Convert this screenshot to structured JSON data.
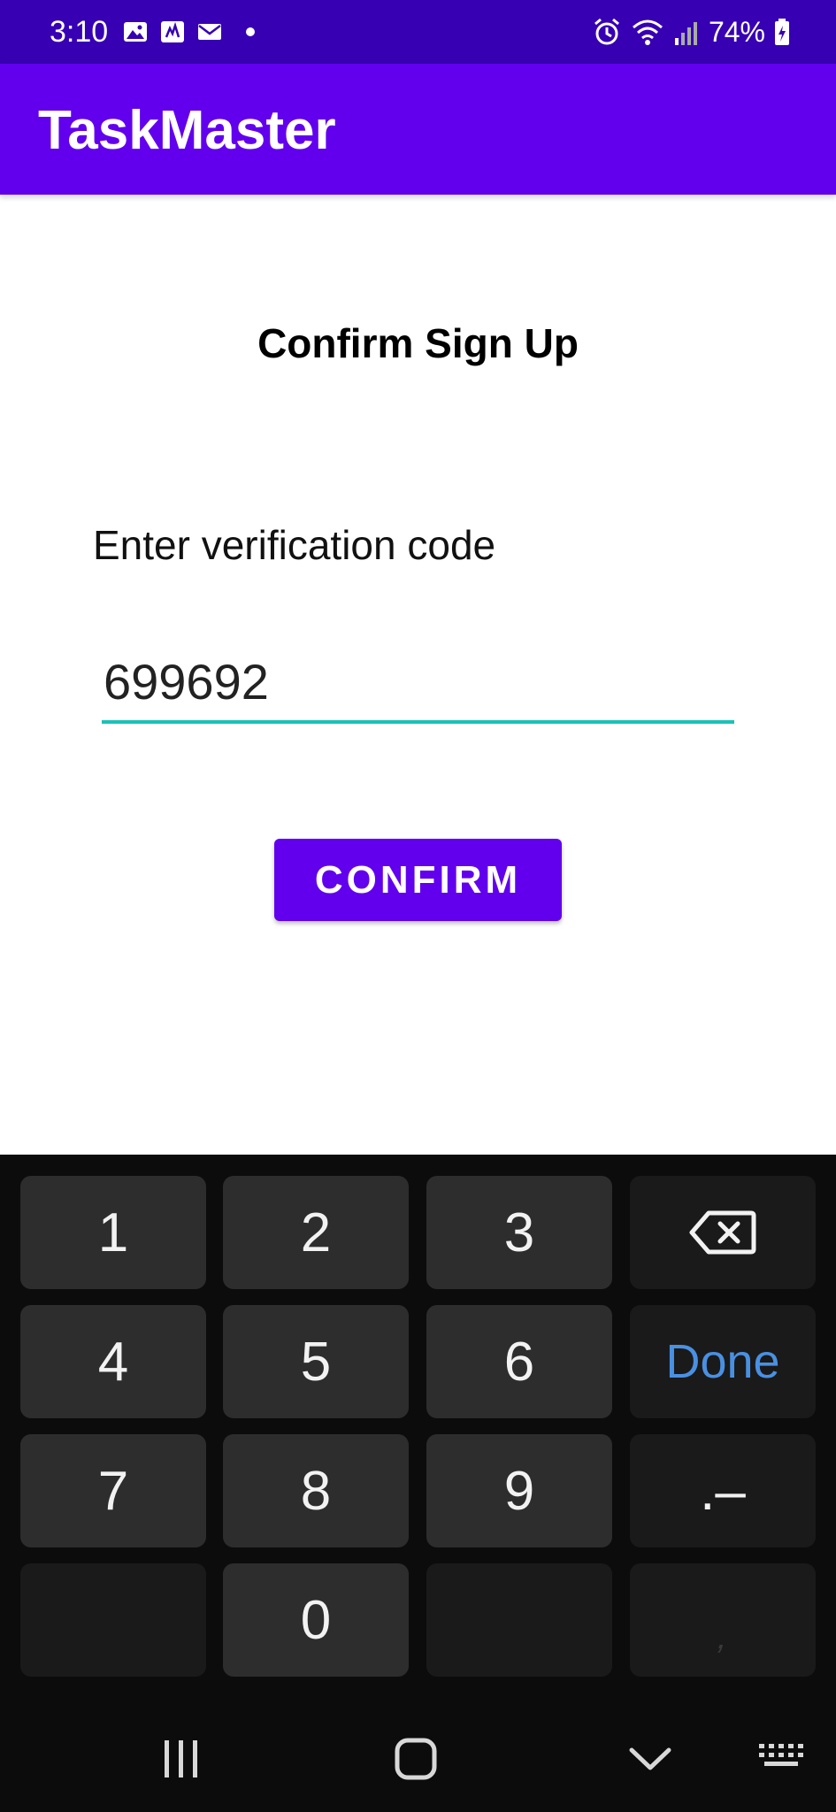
{
  "status_bar": {
    "time": "3:10",
    "battery": "74%",
    "left_icons": [
      "image-icon",
      "signal-app-icon",
      "mail-icon",
      "dot-icon"
    ],
    "right_icons": [
      "alarm-icon",
      "wifi-icon",
      "cell-signal-icon",
      "battery-icon"
    ]
  },
  "app_bar": {
    "title": "TaskMaster"
  },
  "main": {
    "heading": "Confirm Sign Up",
    "code_label": "Enter verification code",
    "code_value": "699692",
    "confirm_label": "CONFIRM"
  },
  "keyboard": {
    "keys": {
      "k1": "1",
      "k2": "2",
      "k3": "3",
      "k4": "4",
      "k5": "5",
      "k6": "6",
      "k7": "7",
      "k8": "8",
      "k9": "9",
      "k0": "0",
      "done": "Done",
      "dot_dash": ".–",
      "comma": ","
    },
    "backspace_icon": "backspace-icon"
  },
  "nav_bar": {
    "icons": [
      "recents-icon",
      "home-icon",
      "back-chevron-icon",
      "keyboard-switch-icon"
    ]
  },
  "colors": {
    "status_bar": "#3700b3",
    "primary": "#6200ee",
    "input_underline": "#19c2b8",
    "keyboard_bg": "#0c0c0c",
    "key_bg": "#2d2d2d",
    "done_text": "#4a90e2"
  }
}
